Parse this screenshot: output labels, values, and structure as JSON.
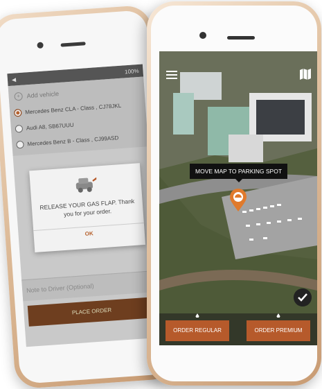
{
  "back_phone": {
    "status_text": "100%",
    "add_vehicle_label": "Add vehicle",
    "vehicles": [
      {
        "label": "Mercedes Benz  CLA - Class , CJ78JKL",
        "selected": true
      },
      {
        "label": "Audi A8, SB67UUU",
        "selected": false
      },
      {
        "label": "Mercedes Benz  B - Class , CJ99ASD",
        "selected": false
      }
    ],
    "modal": {
      "message": "RELEASE YOUR GAS FLAP. Thank you for your order.",
      "ok_label": "OK"
    },
    "note_placeholder": "Note to Driver (Optional)",
    "place_order_label": "PLACE ORDER"
  },
  "front_phone": {
    "tooltip": "MOVE MAP TO PARKING SPOT",
    "order_regular_label": "ORDER REGULAR",
    "order_premium_label": "ORDER PREMIUM"
  },
  "colors": {
    "accent": "#b65a2b",
    "dark_accent": "#6e3e1f"
  },
  "icons": [
    "menu-icon",
    "map-icon",
    "location-pin-icon",
    "checkmark-icon",
    "fuel-drop-icon",
    "car-fuel-icon"
  ]
}
